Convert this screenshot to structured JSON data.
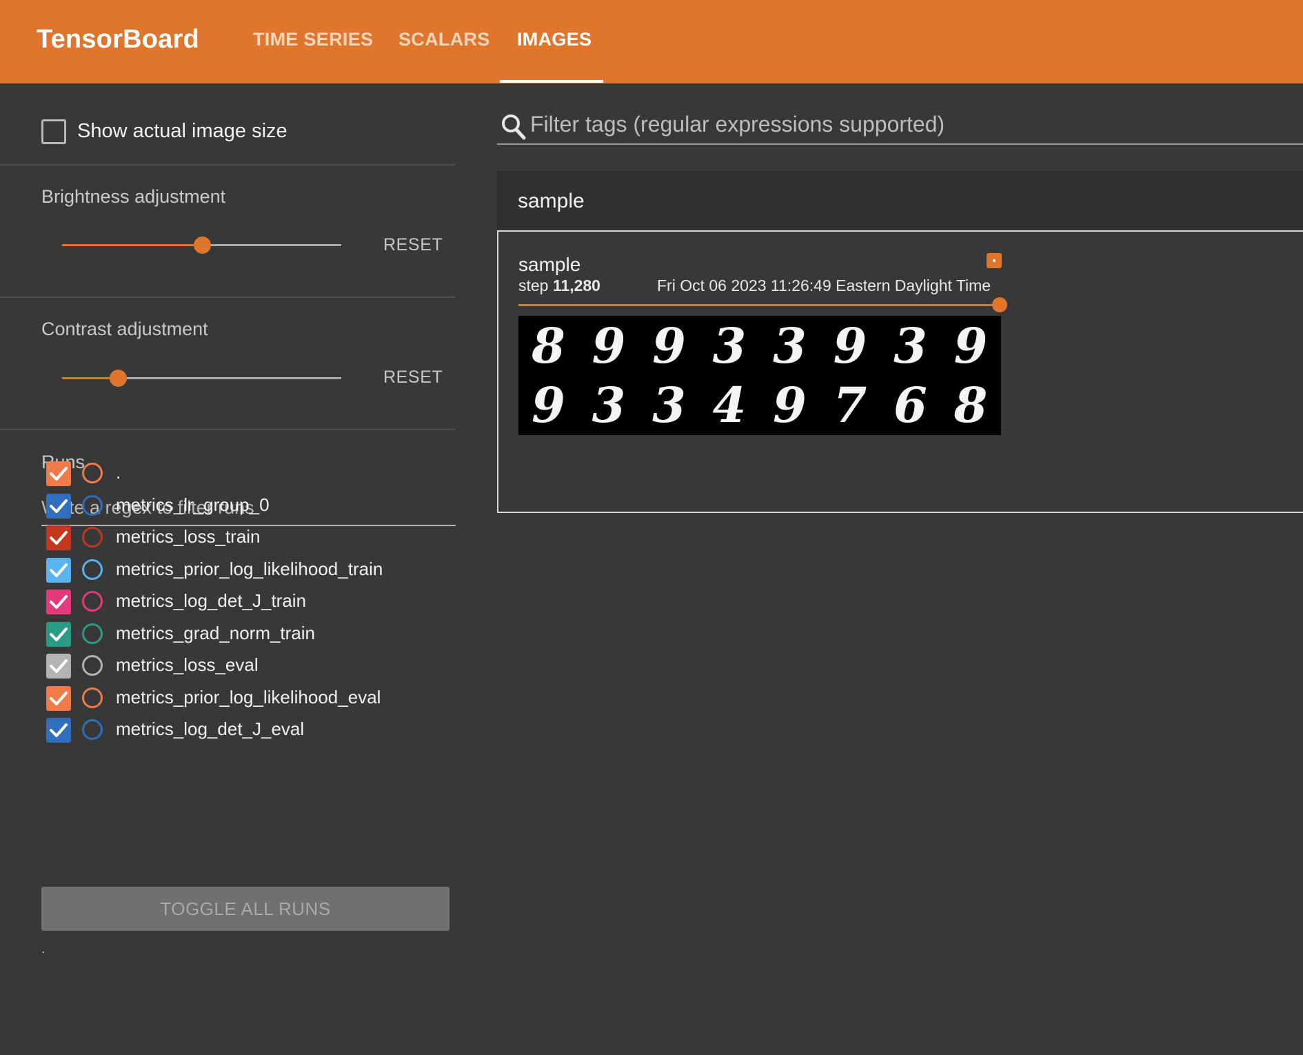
{
  "toolbar": {
    "brand": "TensorBoard",
    "tabs": [
      {
        "label": "TIME SERIES",
        "active": false
      },
      {
        "label": "SCALARS",
        "active": false
      },
      {
        "label": "IMAGES",
        "active": true
      }
    ],
    "accent_color": "#e0762e"
  },
  "sidebar": {
    "show_actual_size": {
      "label": "Show actual image size",
      "checked": false
    },
    "brightness": {
      "label": "Brightness adjustment",
      "value_fraction": 0.5,
      "reset_label": "RESET"
    },
    "contrast": {
      "label": "Contrast adjustment",
      "value_fraction": 0.2,
      "reset_label": "RESET"
    },
    "runs": {
      "title": "Runs",
      "filter_placeholder": "Write a regex to filter runs",
      "items": [
        {
          "name": ".",
          "color": "#ef7b4a",
          "checked": true
        },
        {
          "name": "metrics_lr_group_0",
          "color": "#2f6fbd",
          "checked": true
        },
        {
          "name": "metrics_loss_train",
          "color": "#c4361d",
          "checked": true
        },
        {
          "name": "metrics_prior_log_likelihood_train",
          "color": "#58b4ee",
          "checked": true
        },
        {
          "name": "metrics_log_det_J_train",
          "color": "#e43a7c",
          "checked": true
        },
        {
          "name": "metrics_grad_norm_train",
          "color": "#2a9b84",
          "checked": true
        },
        {
          "name": "metrics_loss_eval",
          "color": "#b3b3b3",
          "checked": true
        },
        {
          "name": "metrics_prior_log_likelihood_eval",
          "color": "#ef7b4a",
          "checked": true
        },
        {
          "name": "metrics_log_det_J_eval",
          "color": "#2f6fbd",
          "checked": true
        }
      ],
      "toggle_all_label": "TOGGLE ALL RUNS",
      "footnote": "."
    }
  },
  "main": {
    "search": {
      "icon": "search-icon",
      "placeholder": "Filter tags (regular expressions supported)"
    },
    "pane": {
      "title": "sample",
      "card": {
        "tag": "sample",
        "step_prefix": "step ",
        "step_value": "11,280",
        "timestamp": "Fri Oct 06 2023 11:26:49 Eastern Daylight Time",
        "step_slider_fraction": 1.0,
        "image_digits": [
          [
            "8",
            "9",
            "9",
            "3",
            "3",
            "9",
            "3",
            "9"
          ],
          [
            "9",
            "3",
            "3",
            "4",
            "9",
            "7",
            "6",
            "8"
          ]
        ]
      }
    }
  }
}
